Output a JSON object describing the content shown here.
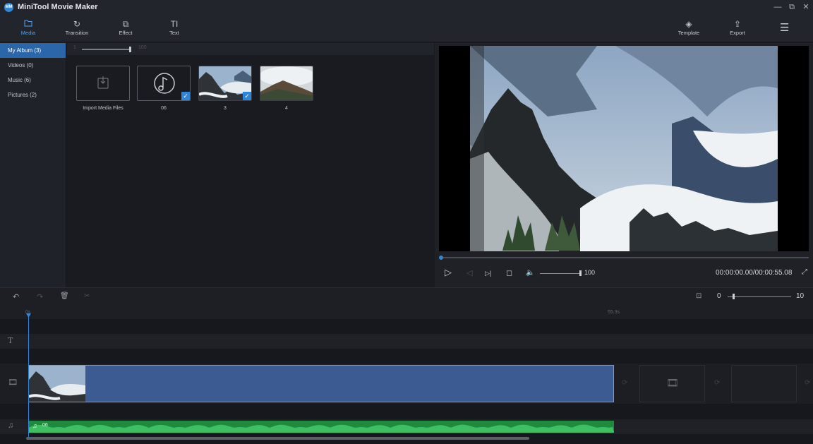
{
  "app": {
    "title": "MiniTool Movie Maker",
    "logo_text": "MM"
  },
  "window_controls": {
    "minimize": "—",
    "restore": "⧉",
    "close": "✕"
  },
  "toolbar": {
    "tabs": [
      {
        "label": "Media",
        "icon": "folder-icon",
        "glyph": "🗀",
        "active": true
      },
      {
        "label": "Transition",
        "icon": "transition-icon",
        "glyph": "↻"
      },
      {
        "label": "Effect",
        "icon": "effect-icon",
        "glyph": "⧉"
      },
      {
        "label": "Text",
        "icon": "text-icon",
        "glyph": "TI"
      }
    ],
    "right": [
      {
        "label": "Template",
        "icon": "layers-icon",
        "glyph": "◈"
      },
      {
        "label": "Export",
        "icon": "export-icon",
        "glyph": "⇪"
      }
    ],
    "menu_glyph": "☰"
  },
  "sidebar": {
    "items": [
      {
        "label": "My Album  (3)",
        "active": true
      },
      {
        "label": "Videos  (0)"
      },
      {
        "label": "Music  (6)"
      },
      {
        "label": "Pictures  (2)"
      }
    ]
  },
  "media": {
    "zoom": {
      "min": "1",
      "max": "100",
      "value": 100
    },
    "tiles": [
      {
        "caption": "Import Media Files",
        "kind": "import",
        "icon": "import-icon"
      },
      {
        "caption": "06",
        "kind": "music",
        "icon": "music-note-icon",
        "checked": true
      },
      {
        "caption": "3",
        "kind": "image-mist",
        "checked": true
      },
      {
        "caption": "4",
        "kind": "image-ridge"
      }
    ],
    "check_glyph": "✓"
  },
  "player": {
    "controls": {
      "play": "▷",
      "prev": "◁",
      "next_frame": "▷|",
      "stop": "◻",
      "volume": "🔈"
    },
    "volume": "100",
    "volume_level": 100,
    "timecode": "00:00:00.00/00:00:55.08",
    "progress": 0,
    "fullscreen_glyph": "⤢"
  },
  "timeline_toolbar": {
    "undo": "↶",
    "redo": "↷",
    "delete": "🗑",
    "cut": "✂",
    "fit": "⊡",
    "zoom_min": "0",
    "zoom_max": "10"
  },
  "timeline": {
    "ruler": {
      "start": "0s",
      "end_mark": "55.3s"
    },
    "tracks": {
      "text_icon": "T",
      "video_icon": "🎞",
      "audio_icon": "♫"
    },
    "audio_clip": {
      "label": "06",
      "icon": "♫"
    },
    "empty_slot_icon": "🎞",
    "transition_glyph": "⟳"
  }
}
